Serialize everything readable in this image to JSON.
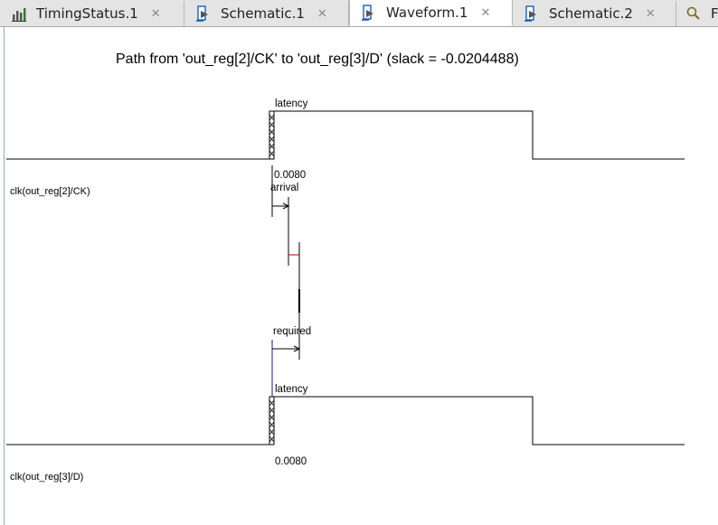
{
  "tabs": [
    {
      "label": "TimingStatus.1",
      "icon": "timing-chart-icon",
      "active": false
    },
    {
      "label": "Schematic.1",
      "icon": "schematic-icon",
      "active": false
    },
    {
      "label": "Waveform.1",
      "icon": "waveform-icon",
      "active": true
    },
    {
      "label": "Schematic.2",
      "icon": "schematic-icon",
      "active": false
    },
    {
      "label": "F",
      "icon": "search-icon",
      "active": false
    }
  ],
  "close_glyph": "✕",
  "waveform": {
    "title": "Path from 'out_reg[2]/CK' to 'out_reg[3]/D' (slack = -0.0204488)",
    "launch_clock": {
      "signal_label": "clk(out_reg[2]/CK)",
      "latency_label": "latency",
      "latency_value": "0.0080",
      "arrival_label": "arrival"
    },
    "capture_clock": {
      "signal_label": "clk(out_reg[3]/D)",
      "latency_label": "latency",
      "latency_value": "0.0080",
      "required_label": "required"
    }
  },
  "colors": {
    "tab_bg": "#e4e4e4",
    "active_tab_bg": "#ffffff",
    "icon_blue": "#1a5fb4",
    "negative_slack": "#c62828",
    "required_marker": "#3b3bb3"
  }
}
